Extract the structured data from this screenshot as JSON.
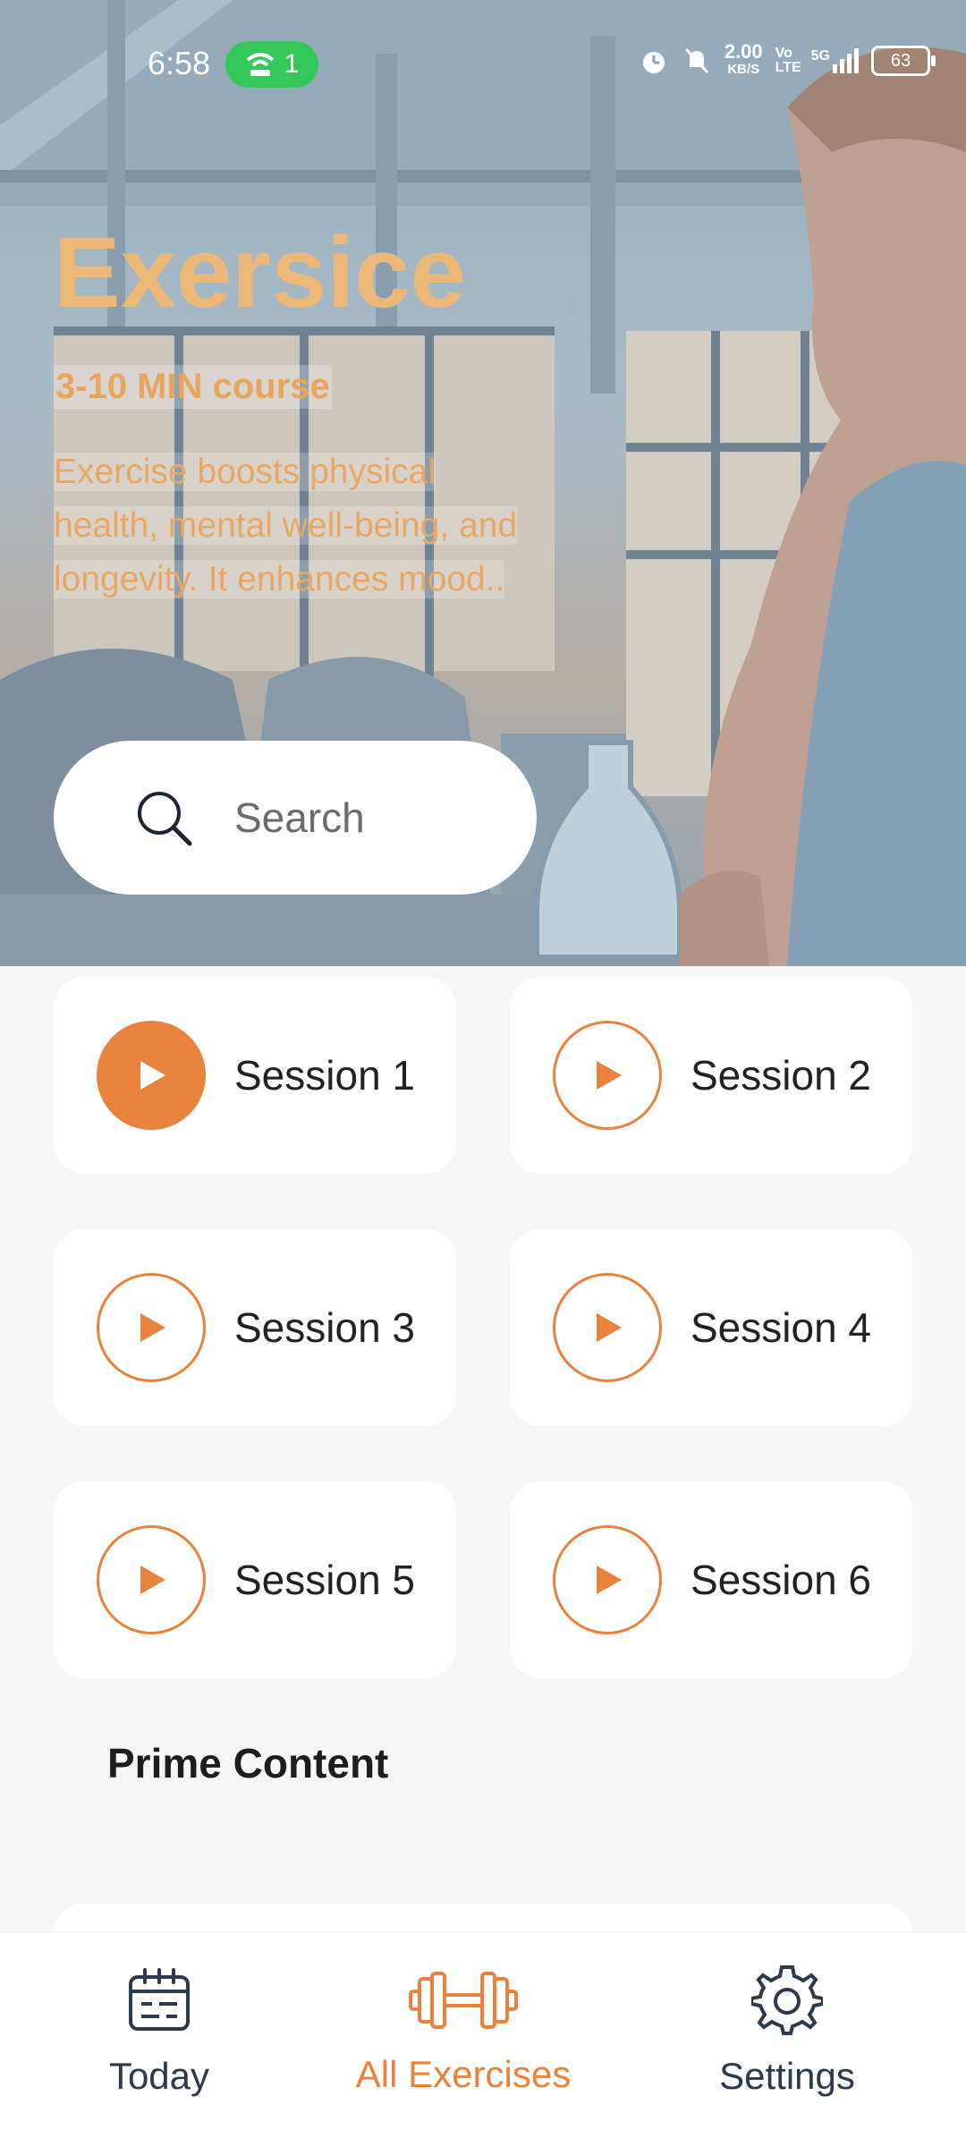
{
  "status_bar": {
    "time": "6:58",
    "hotspot_count": "1",
    "net_speed_value": "2.00",
    "net_speed_unit": "KB/S",
    "volte": "Vo LTE",
    "network": "5G",
    "battery": "63"
  },
  "hero": {
    "title": "Exersice",
    "subtitle": "3-10 MIN course",
    "description": "Exercise boosts physical health, mental well-being, and longevity. It enhances mood..",
    "search_placeholder": "Search"
  },
  "sessions": [
    {
      "label": "Session 1",
      "active": true
    },
    {
      "label": "Session 2",
      "active": false
    },
    {
      "label": "Session 3",
      "active": false
    },
    {
      "label": "Session 4",
      "active": false
    },
    {
      "label": "Session 5",
      "active": false
    },
    {
      "label": "Session 6",
      "active": false
    }
  ],
  "prime_section": {
    "title": "Prime Content"
  },
  "bottom_nav": {
    "items": [
      {
        "label": "Today",
        "icon": "calendar-icon",
        "active": false
      },
      {
        "label": "All Exercises",
        "icon": "dumbbell-icon",
        "active": true
      },
      {
        "label": "Settings",
        "icon": "gear-icon",
        "active": false
      }
    ]
  },
  "colors": {
    "accent": "#e8823c",
    "title": "#ecb877",
    "nav_inactive": "#2d3a4a"
  }
}
